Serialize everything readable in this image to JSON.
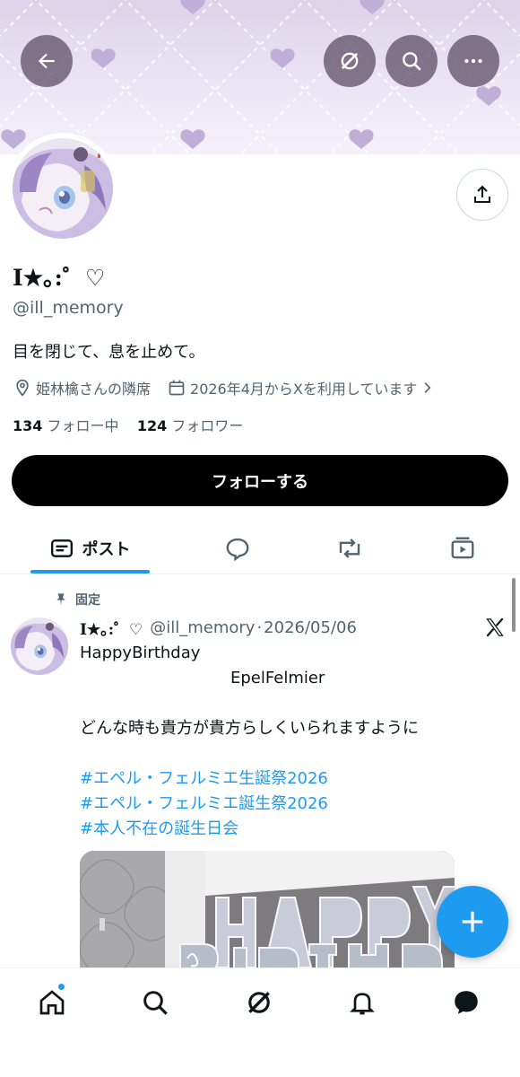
{
  "header": {
    "back_icon": "arrow-left-icon",
    "grok_icon": "grok-icon",
    "search_icon": "search-icon",
    "more_icon": "more-icon"
  },
  "profile": {
    "display_name": "I★｡:゜♡",
    "handle": "@ill_memory",
    "bio": "目を閉じて、息を止めて。",
    "location": "姫林檎さんの隣席",
    "joined": "2026年4月からXを利用しています",
    "following_count": "134",
    "following_label": "フォロー中",
    "followers_count": "124",
    "followers_label": "フォロワー",
    "follow_button": "フォローする"
  },
  "tabs": [
    {
      "label": "ポスト",
      "icon": "posts-icon",
      "selected": true
    },
    {
      "label": "",
      "icon": "replies-icon",
      "selected": false
    },
    {
      "label": "",
      "icon": "repost-icon",
      "selected": false
    },
    {
      "label": "",
      "icon": "media-icon",
      "selected": false
    }
  ],
  "post": {
    "pinned_label": "固定",
    "author_name": "I★｡:゜♡",
    "author_handle": "@ill_memory",
    "separator": "·",
    "date": "2026/05/06",
    "line1": "HappyBirthday",
    "line2": "EpelFelmier",
    "line3": "どんな時も貴方が貴方らしくいられますように",
    "hashtags": [
      "#エペル・フェルミエ生誕祭2026",
      "#エペル・フェルミエ誕生祭2026",
      "#本人不在の誕生日会"
    ]
  },
  "fab_icon": "compose-plus-icon",
  "bottom_nav": [
    "home-icon",
    "search-icon",
    "grok-icon",
    "notifications-icon",
    "messages-icon"
  ],
  "colors": {
    "accent": "#1d9bf0",
    "text": "#0f1419",
    "secondary": "#536471",
    "banner": "#e6dff0"
  }
}
